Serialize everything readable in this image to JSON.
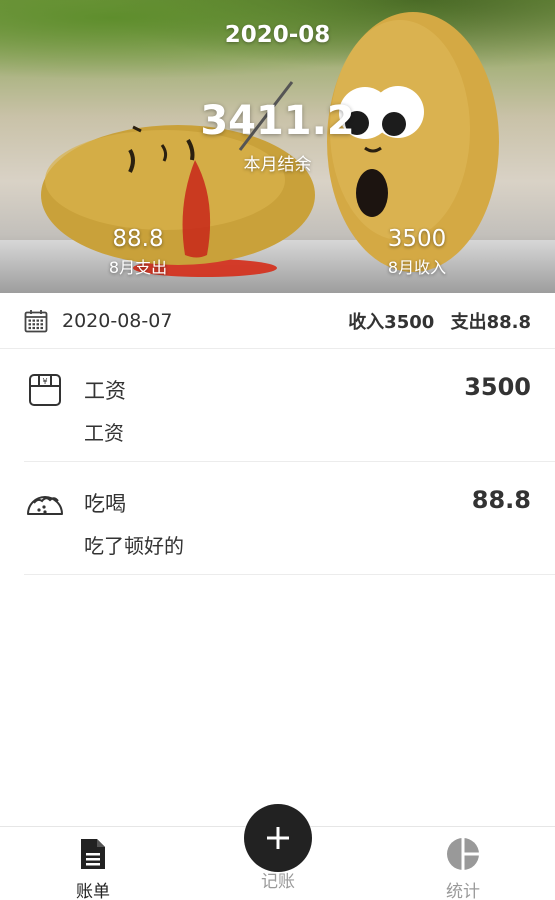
{
  "header": {
    "month": "2020-08",
    "balance": "3411.2",
    "balance_label": "本月结余",
    "expense_value": "88.8",
    "expense_label": "8月支出",
    "income_value": "3500",
    "income_label": "8月收入"
  },
  "day": {
    "date": "2020-08-07",
    "income_summary": "收入3500",
    "expense_summary": "支出88.8",
    "icon": "calendar-icon"
  },
  "records": [
    {
      "category": "工资",
      "note": "工资",
      "amount": "3500",
      "icon": "wallet-icon"
    },
    {
      "category": "吃喝",
      "note": "吃了顿好的",
      "amount": "88.8",
      "icon": "taco-icon"
    }
  ],
  "tabbar": {
    "bill_label": "账单",
    "add_label": "记账",
    "stats_label": "统计",
    "bill_icon": "document-icon",
    "add_icon": "plus-icon",
    "stats_icon": "pie-chart-icon"
  },
  "colors": {
    "text": "#333333",
    "active_tab": "#222222",
    "inactive_tab": "#9a9a9a",
    "fab": "#222222"
  }
}
